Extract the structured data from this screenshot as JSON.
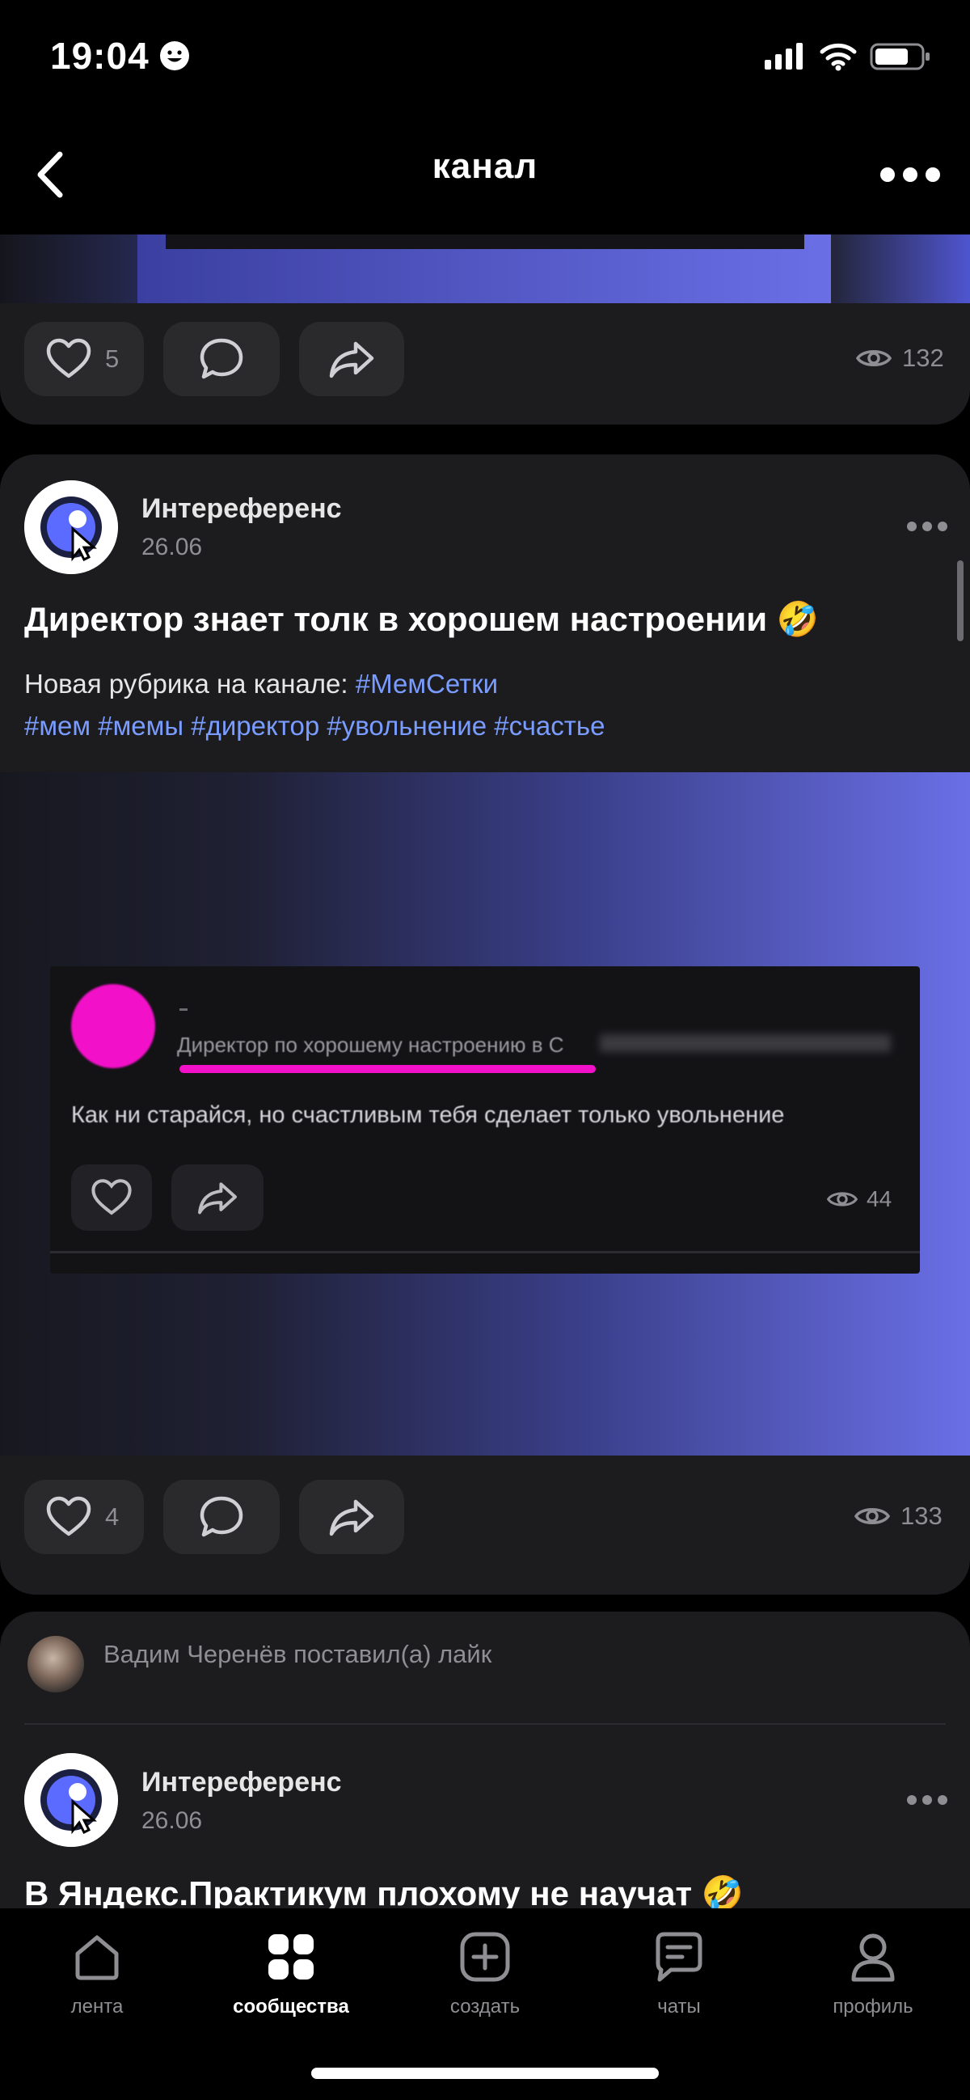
{
  "status_bar": {
    "time": "19:04"
  },
  "nav": {
    "title": "канал",
    "back_icon": "chevron-left-icon",
    "more_icon": "more-horizontal-icon"
  },
  "post1": {
    "likes": "5",
    "views": "132"
  },
  "post2": {
    "author": "Интереференс",
    "date": "26.06",
    "title": "Директор знает толк в хорошем настроении 🤣",
    "text_prefix": "Новая рубрика на канале: ",
    "rubric_tag": "#МемСетки",
    "tags": "#мем #мемы #директор #увольнение #счастье",
    "meme": {
      "line1": "Директор по хорошему настроению в С",
      "text": "Как ни старайся, но счастливым тебя сделает только увольнение",
      "views": "44",
      "circle_color": "#f211c9"
    },
    "likes": "4",
    "views": "133"
  },
  "post3": {
    "liked_by": "Вадим Черенёв поставил(а) лайк",
    "author": "Интереференс",
    "date": "26.06",
    "title": "В Яндекс.Практикум плохому не научат 🤣"
  },
  "tabbar": {
    "tabs": [
      {
        "label": "лента",
        "icon": "home-icon"
      },
      {
        "label": "сообщества",
        "icon": "communities-icon"
      },
      {
        "label": "создать",
        "icon": "create-icon"
      },
      {
        "label": "чаты",
        "icon": "chat-icon"
      },
      {
        "label": "профиль",
        "icon": "profile-icon"
      }
    ],
    "active": "сообщества"
  },
  "colors": {
    "accent": "#7a9cff",
    "card": "#1c1c1e",
    "meme_accent": "#f211c9",
    "gradient_end": "#6a6fe6"
  }
}
